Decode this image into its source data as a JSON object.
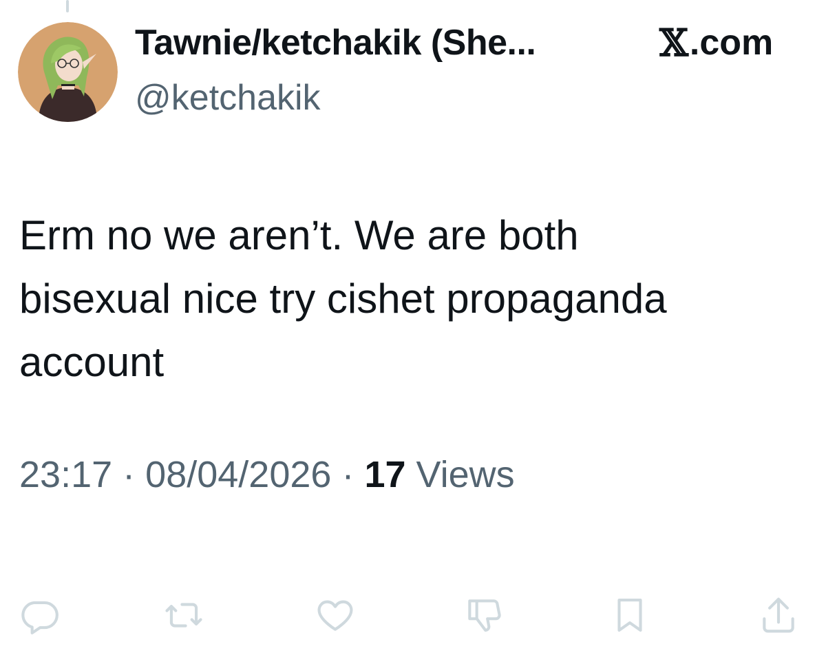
{
  "tweet": {
    "display_name": "Tawnie/ketchakik (She...",
    "handle": "@ketchakik",
    "source_glyph": "𝕏",
    "source_suffix": ".com",
    "text_lines": [
      "Erm no we aren’t. We are both",
      "bisexual nice try cishet propaganda",
      "account"
    ],
    "time": "23:17",
    "date": "08/04/2026",
    "separator": "·",
    "views_count": "17",
    "views_label": "Views"
  },
  "actions": [
    {
      "name": "reply-icon"
    },
    {
      "name": "retweet-icon"
    },
    {
      "name": "like-icon"
    },
    {
      "name": "dislike-icon"
    },
    {
      "name": "bookmark-icon"
    },
    {
      "name": "share-icon"
    }
  ],
  "colors": {
    "text": "#0f1419",
    "secondary": "#536471",
    "icon": "#cfd9de",
    "avatar_bg": "#d6a26f"
  }
}
